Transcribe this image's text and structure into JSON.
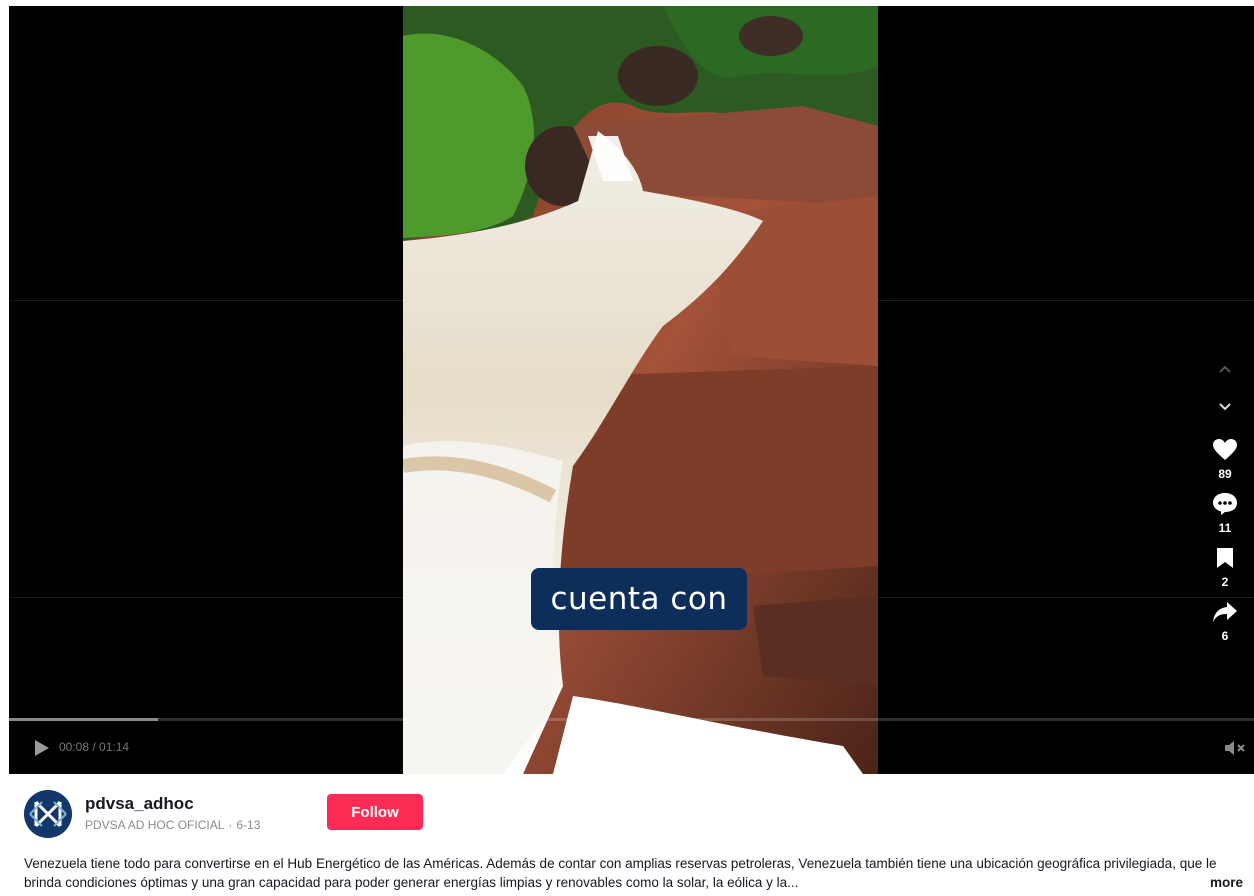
{
  "player": {
    "caption": "cuenta con",
    "time": "00:08 / 01:14",
    "progress": 0.12
  },
  "actions": {
    "likes": "89",
    "comments": "11",
    "saves": "2",
    "shares": "6"
  },
  "author": {
    "username": "pdvsa_adhoc",
    "display_name": "PDVSA AD HOC OFICIAL",
    "separator": "·",
    "date": "6-13"
  },
  "follow_label": "Follow",
  "description": "Venezuela tiene todo para convertirse en el Hub Energético de las Américas. Además de contar con amplias reservas petroleras, Venezuela también tiene una ubicación geográfica privilegiada, que le brinda condiciones óptimas y una gran capacidad para poder generar energías limpias y renovables como la solar, la eólica y la...",
  "more_label": "more",
  "colors": {
    "follow": "#fe2c55",
    "caption_bg": "#0d2e5a",
    "avatar_bg": "#12386b"
  },
  "icons": [
    "chevron-up-icon",
    "chevron-down-icon",
    "heart-icon",
    "comment-icon",
    "bookmark-icon",
    "share-icon",
    "play-icon",
    "mute-icon"
  ]
}
